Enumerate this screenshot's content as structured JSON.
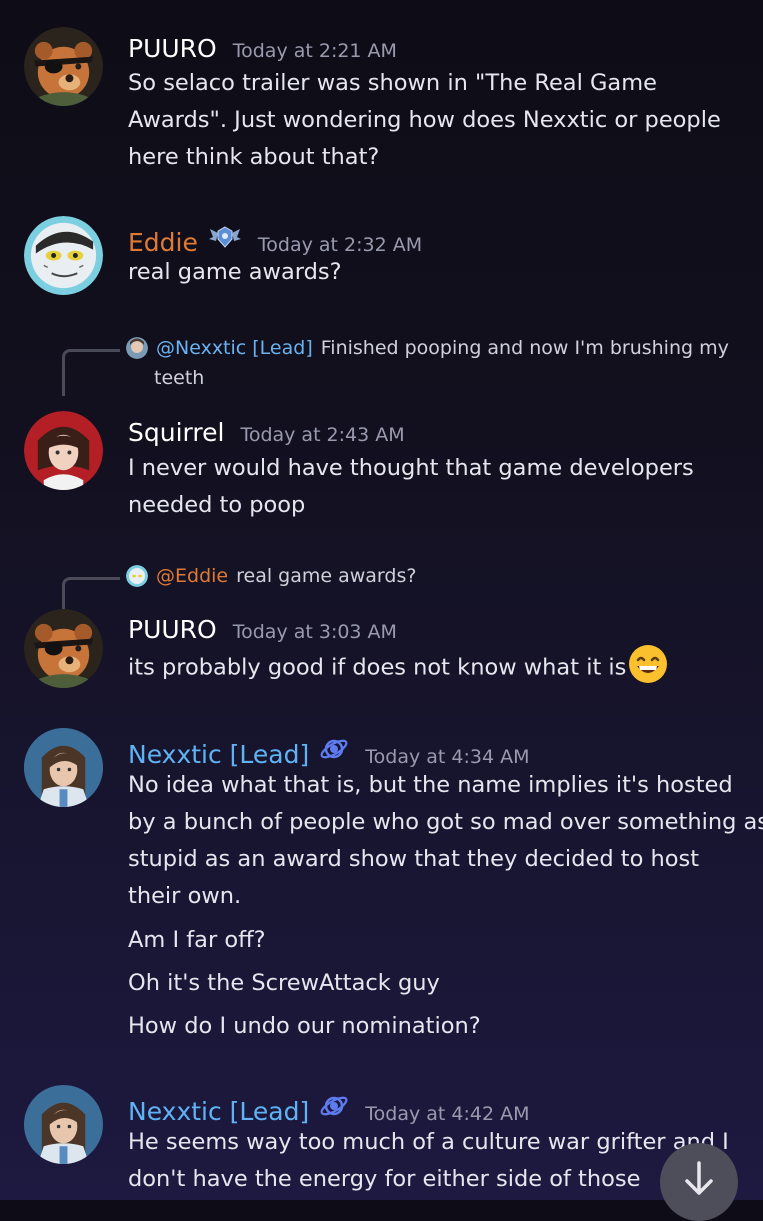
{
  "messages": [
    {
      "author": "PUURO",
      "author_color": "#ffffff",
      "timestamp": "Today at 2:21 AM",
      "lines": [
        "So selaco trailer was shown in \"The Real Game",
        "Awards\". Just wondering how does Nexxtic or people",
        "here think about that?"
      ]
    },
    {
      "author": "Eddie",
      "author_color": "#df7a35",
      "timestamp": "Today at 2:32 AM",
      "badge": "wings-shield-icon",
      "lines": [
        "real game awards?"
      ]
    },
    {
      "reply": {
        "mention": "@Nexxtic [Lead]",
        "text": "Finished pooping and now I'm brushing my",
        "text_cont": "teeth"
      },
      "author": "Squirrel",
      "author_color": "#ffffff",
      "timestamp": "Today at 2:43 AM",
      "lines": [
        "I never would have thought that game developers",
        "needed to poop"
      ]
    },
    {
      "reply": {
        "mention": "@Eddie",
        "text": "real game awards?"
      },
      "author": "PUURO",
      "author_color": "#ffffff",
      "timestamp": "Today at 3:03 AM",
      "lines": [
        "its probably good if does not know what it is"
      ],
      "emoji": "grinning-smile-emoji"
    },
    {
      "author": "Nexxtic [Lead]",
      "author_color": "#5fb3f5",
      "timestamp": "Today at 4:34 AM",
      "badge": "planet-icon",
      "lines": [
        "No idea what that is, but the name implies it's hosted",
        "by a bunch of people who got so mad over something as",
        "stupid as an award show that they decided to host",
        "their own."
      ],
      "followups": [
        "Am I far off?",
        "Oh it's the ScrewAttack guy",
        "How do I undo our nomination?"
      ]
    },
    {
      "author": "Nexxtic [Lead]",
      "author_color": "#5fb3f5",
      "timestamp": "Today at 4:42 AM",
      "badge": "planet-icon",
      "lines": [
        "He seems way too much of a culture war grifter and I",
        "don't have the energy for either side of those"
      ]
    }
  ],
  "scroll_button_icon": "arrow-down-icon"
}
